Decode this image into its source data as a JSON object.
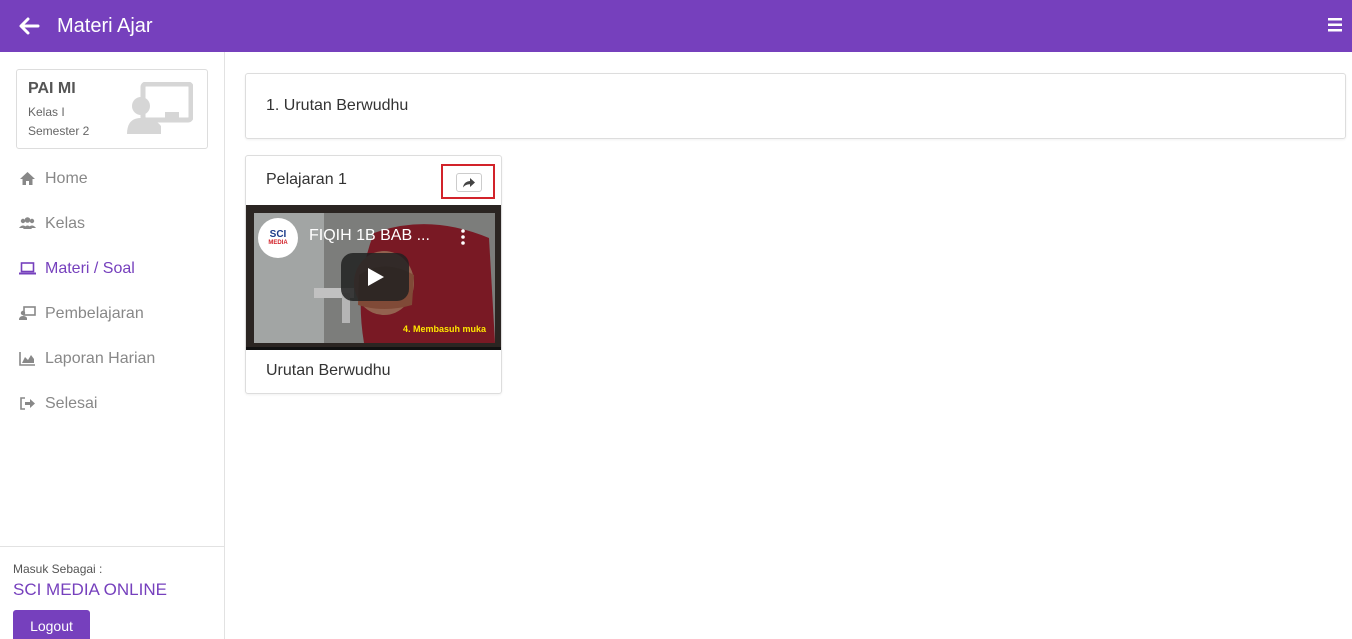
{
  "header": {
    "title": "Materi Ajar",
    "back_icon": "arrow-left-icon",
    "menu_icon": "hamburger-icon",
    "bg_color": "#7640bd"
  },
  "course": {
    "name": "PAI MI",
    "class": "Kelas I",
    "semester": "Semester 2",
    "icon": "teacher-board-icon"
  },
  "nav": [
    {
      "label": "Home",
      "icon": "home-icon",
      "active": false
    },
    {
      "label": "Kelas",
      "icon": "users-icon",
      "active": false
    },
    {
      "label": "Materi / Soal",
      "icon": "laptop-icon",
      "active": true
    },
    {
      "label": "Pembelajaran",
      "icon": "teacher-icon",
      "active": false
    },
    {
      "label": "Laporan Harian",
      "icon": "area-chart-icon",
      "active": false
    },
    {
      "label": "Selesai",
      "icon": "sign-out-icon",
      "active": false
    }
  ],
  "footer": {
    "label": "Masuk Sebagai :",
    "user": "SCI MEDIA ONLINE",
    "logout": "Logout"
  },
  "main": {
    "heading": "1. Urutan Berwudhu",
    "lesson": {
      "title": "Pelajaran 1",
      "share_icon": "share-icon",
      "video": {
        "channel_logo_line1": "SCI",
        "channel_logo_line2": "MEDIA",
        "title": "FIQIH 1B BAB ...",
        "caption": "4. Membasuh muka"
      },
      "description": "Urutan Berwudhu"
    }
  },
  "colors": {
    "accent": "#7640bd",
    "highlight": "#d2232a"
  }
}
